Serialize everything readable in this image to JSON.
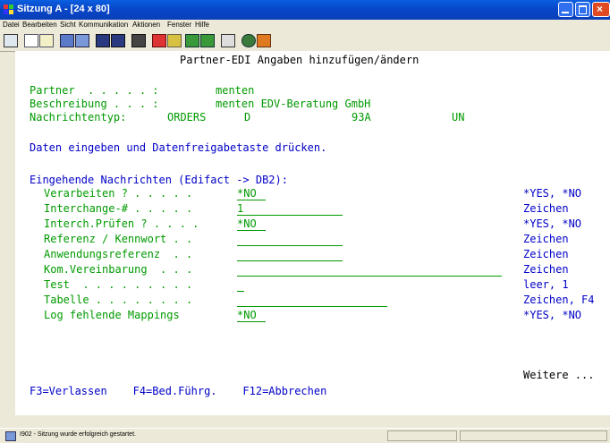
{
  "window": {
    "title": "Sitzung A - [24 x 80]"
  },
  "menu": [
    "Datei",
    "Bearbeiten",
    "Sicht",
    "Kommunikation",
    "Aktionen",
    "Fenster",
    "Hilfe"
  ],
  "toolbar_icons": [
    "print-icon",
    "copy-icon",
    "paste-icon",
    "send-icon",
    "receive-icon",
    "display-icon",
    "keypad-icon",
    "macro-icon",
    "record-icon",
    "play-icon",
    "stop-icon",
    "edit-icon",
    "clipboard-icon",
    "color-icon",
    "pencil-icon"
  ],
  "screen": {
    "heading": "Partner-EDI Angaben hinzufügen/ändern",
    "partner_label": "Partner  . . . . . :",
    "partner_value": "menten",
    "beschreibung_label": "Beschreibung . . . :",
    "beschreibung_value": "menten EDV-Beratung GmbH",
    "nachrichtentyp_label": "Nachrichtentyp:",
    "nachrichtentyp_values": [
      "ORDERS",
      "D",
      "93A",
      "UN"
    ],
    "instruction": "Daten eingeben und Datenfreigabetaste drücken.",
    "section_title": "Eingehende Nachrichten (Edifact -> DB2):",
    "fields": [
      {
        "label": "Verarbeiten ? . . . . .",
        "value": "*NO",
        "hint": "*YES, *NO"
      },
      {
        "label": "Interchange-# . . . . .",
        "value": "1",
        "hint": "Zeichen"
      },
      {
        "label": "Interch.Prüfen ? . . . .",
        "value": "*NO",
        "hint": "*YES, *NO"
      },
      {
        "label": "Referenz / Kennwort . .",
        "value": "",
        "hint": "Zeichen"
      },
      {
        "label": "Anwendungsreferenz  . .",
        "value": "",
        "hint": "Zeichen"
      },
      {
        "label": "Kom.Vereinbarung  . . .",
        "value": "",
        "hint": "Zeichen"
      },
      {
        "label": "Test  . . . . . . . . .",
        "value": "",
        "hint": "leer, 1"
      },
      {
        "label": "Tabelle . . . . . . . .",
        "value": "",
        "hint": "Zeichen, F4"
      },
      {
        "label": "Log fehlende Mappings",
        "value": "*NO",
        "hint": "*YES, *NO"
      }
    ],
    "more": "Weitere ...",
    "fkeys": "F3=Verlassen    F4=Bed.Führg.    F12=Abbrechen"
  },
  "status": {
    "message": "I902 - Sitzung wurde erfolgreich gestartet."
  }
}
